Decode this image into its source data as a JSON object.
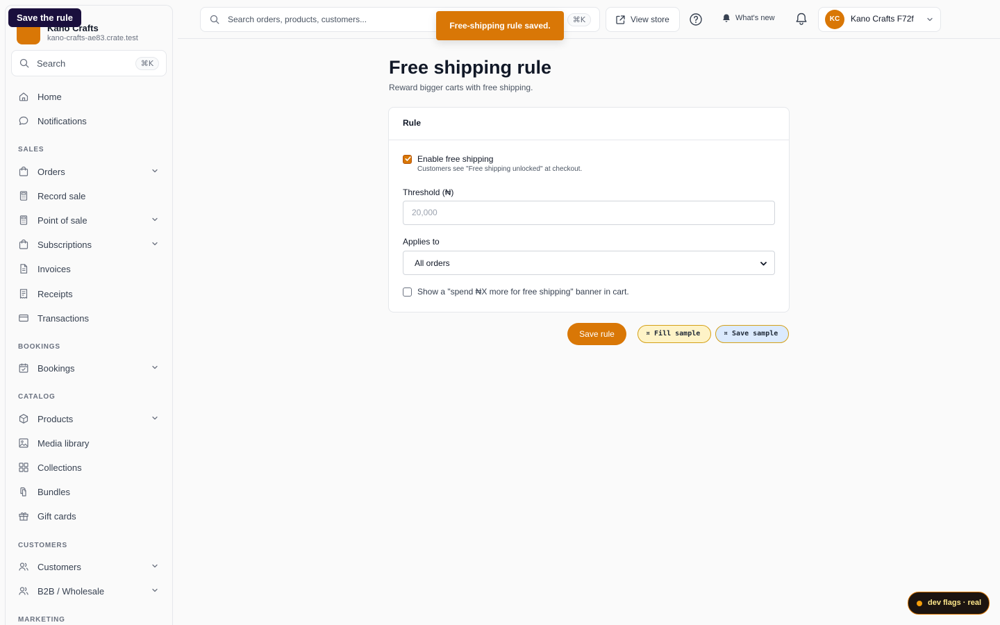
{
  "tooltip": "Save the rule",
  "brand": {
    "name": "Kano Crafts",
    "domain": "kano-crafts-ae83.crate.test"
  },
  "sidebar": {
    "search": {
      "label": "Search",
      "shortcut": "⌘K"
    },
    "top_items": [
      {
        "label": "Home",
        "icon": "home-icon"
      },
      {
        "label": "Notifications",
        "icon": "chat-bubble-icon"
      }
    ],
    "sections": {
      "sales": "SALES",
      "bookings": "BOOKINGS",
      "catalog": "CATALOG",
      "customers": "CUSTOMERS",
      "marketing": "MARKETING"
    },
    "sales_items": [
      {
        "label": "Orders",
        "icon": "bag-icon",
        "expandable": true
      },
      {
        "label": "Record sale",
        "icon": "calculator-icon",
        "expandable": false
      },
      {
        "label": "Point of sale",
        "icon": "calculator-icon",
        "expandable": true
      },
      {
        "label": "Subscriptions",
        "icon": "bag-icon",
        "expandable": true
      },
      {
        "label": "Invoices",
        "icon": "document-icon",
        "expandable": false
      },
      {
        "label": "Receipts",
        "icon": "receipt-icon",
        "expandable": false
      },
      {
        "label": "Transactions",
        "icon": "card-icon",
        "expandable": false
      }
    ],
    "bookings_items": [
      {
        "label": "Bookings",
        "icon": "calendar-icon",
        "expandable": true
      }
    ],
    "catalog_items": [
      {
        "label": "Products",
        "icon": "box-icon",
        "expandable": true
      },
      {
        "label": "Media library",
        "icon": "image-icon",
        "expandable": false
      },
      {
        "label": "Collections",
        "icon": "grid-icon",
        "expandable": false
      },
      {
        "label": "Bundles",
        "icon": "bundle-icon",
        "expandable": false
      },
      {
        "label": "Gift cards",
        "icon": "gift-icon",
        "expandable": false
      }
    ],
    "customers_items": [
      {
        "label": "Customers",
        "icon": "users-icon",
        "expandable": true
      },
      {
        "label": "B2B / Wholesale",
        "icon": "users-icon",
        "expandable": true
      }
    ]
  },
  "topbar": {
    "search_placeholder": "Search orders, products, customers...",
    "search_shortcut": "⌘K",
    "view_store": "View store",
    "whats_new": "What's new",
    "account_initials": "KC",
    "account_name": "Kano Crafts F72f"
  },
  "toast": "Free-shipping rule saved.",
  "page": {
    "title": "Free shipping rule",
    "subtitle": "Reward bigger carts with free shipping."
  },
  "card": {
    "title": "Rule",
    "enable_label": "Enable free shipping",
    "enable_checked": true,
    "enable_help": "Customers see \"Free shipping unlocked\" at checkout.",
    "threshold_label": "Threshold (₦)",
    "threshold_placeholder": "20,000",
    "applies_label": "Applies to",
    "applies_value": "All orders",
    "banner_label": "Show a \"spend ₦X more for free shipping\" banner in cart.",
    "banner_checked": false
  },
  "actions": {
    "save_rule": "Save rule",
    "fill_sample": "¤ Fill sample",
    "save_sample": "¤ Save sample"
  },
  "dev_flags": "dev flags · real",
  "colors": {
    "accent": "#d97706",
    "tooltip_bg": "#1a0f3d"
  }
}
